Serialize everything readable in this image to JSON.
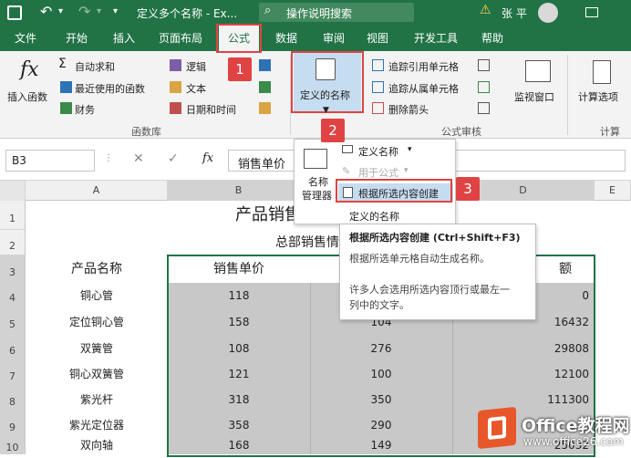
{
  "title": {
    "doc": "定义多个名称 - Ex...",
    "search_placeholder": "操作说明搜索",
    "user": "张 平",
    "warn": "⚠"
  },
  "tabs": [
    "文件",
    "开始",
    "插入",
    "页面布局",
    "公式",
    "数据",
    "审阅",
    "视图",
    "开发工具",
    "帮助"
  ],
  "ribbon": {
    "insert_fn": "插入函数",
    "fx": "fx",
    "autosum": "自动求和",
    "recent": "最近使用的函数",
    "finance": "财务",
    "logic": "逻辑",
    "text": "文本",
    "datetime": "日期和时间",
    "group_lib": "函数库",
    "defined_names": "定义的名称",
    "trace_prec": "追踪引用单元格",
    "trace_dep": "追踪从属单元格",
    "remove_arrows": "删除箭头",
    "group_audit": "公式审核",
    "watch": "监视窗口",
    "calc_options": "计算选项",
    "group_calc": "计算"
  },
  "formula_bar": {
    "namebox": "B3",
    "fx": "fx",
    "content": "销售单价"
  },
  "menu": {
    "name_manager_line1": "名称",
    "name_manager_line2": "管理器",
    "define_name": "定义名称",
    "use_in_formula": "用于公式",
    "create_from_sel": "根据所选内容创建",
    "section": "定义的名称"
  },
  "tooltip": {
    "title": "根据所选内容创建 (Ctrl+Shift+F3)",
    "line1": "根据所选单元格自动生成名称。",
    "line2": "许多人会选用所选内容顶行或最左一",
    "line3": "列中的文字。"
  },
  "badges": [
    "1",
    "2",
    "3"
  ],
  "columns": [
    "A",
    "B",
    "C",
    "D",
    "E"
  ],
  "rows": [
    "1",
    "2",
    "3",
    "4",
    "5",
    "6",
    "7",
    "8",
    "9",
    "10"
  ],
  "sheet": {
    "title": "产品销售",
    "subtitle": "总部销售情",
    "headers": [
      "产品名称",
      "销售单价",
      "",
      "额"
    ],
    "data": [
      [
        "铜心管",
        "118",
        "",
        "0"
      ],
      [
        "定位铜心管",
        "158",
        "104",
        "16432"
      ],
      [
        "双簧管",
        "108",
        "276",
        "29808"
      ],
      [
        "铜心双簧管",
        "121",
        "100",
        "12100"
      ],
      [
        "紫光杆",
        "318",
        "350",
        "111300"
      ],
      [
        "紫光定位器",
        "358",
        "290",
        ""
      ],
      [
        "双向轴",
        "168",
        "149",
        "25032"
      ]
    ]
  },
  "watermark": {
    "brand": "Office教程网",
    "url": "www.office26.com"
  },
  "colors": {
    "excel_green": "#217346",
    "badge_red": "#e04343",
    "selection_gray": "#c8c8c8"
  }
}
